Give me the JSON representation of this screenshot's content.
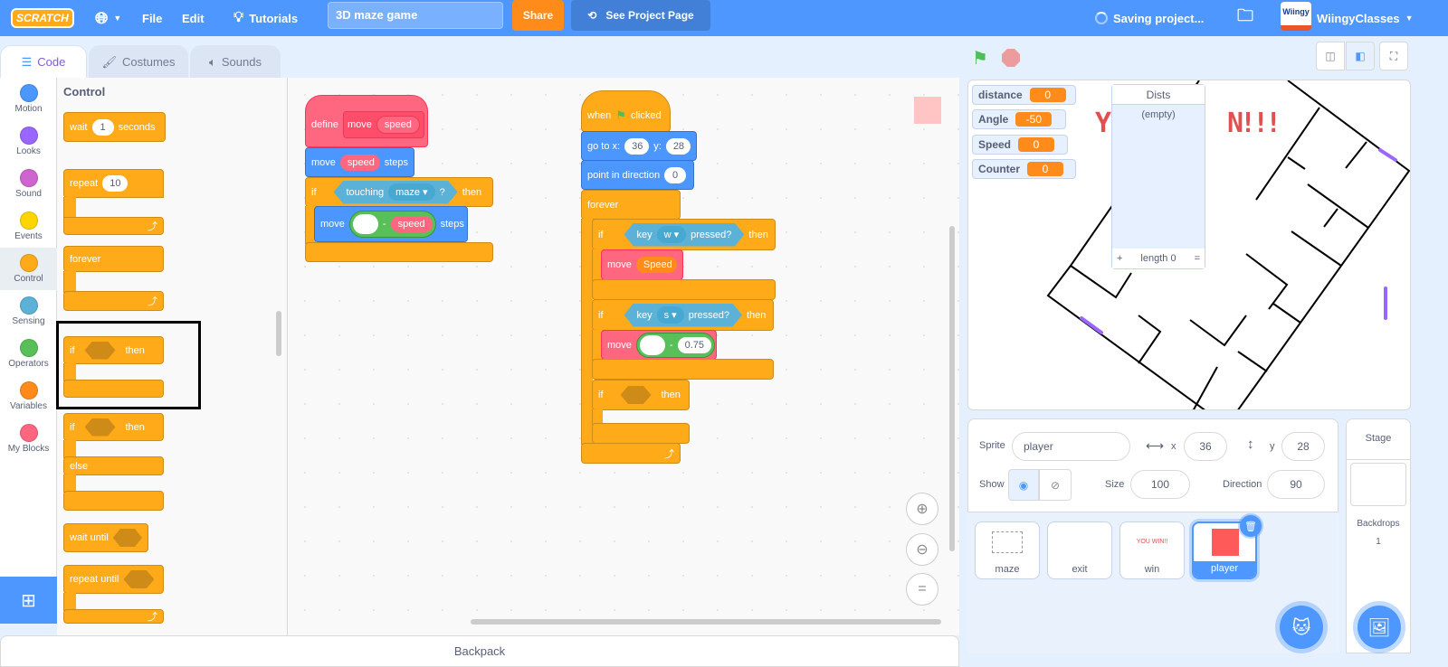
{
  "menu": {
    "logo": "SCRATCH",
    "file": "File",
    "edit": "Edit",
    "tutorials": "Tutorials",
    "project_title": "3D maze game",
    "share": "Share",
    "see_project_page": "See Project Page",
    "saving": "Saving project...",
    "username": "WiingyClasses",
    "avatar_text": "Wiingy"
  },
  "tabs": [
    {
      "label": "Code"
    },
    {
      "label": "Costumes"
    },
    {
      "label": "Sounds"
    }
  ],
  "categories": [
    {
      "label": "Motion",
      "color": "#4c97ff"
    },
    {
      "label": "Looks",
      "color": "#9966ff"
    },
    {
      "label": "Sound",
      "color": "#cf63cf"
    },
    {
      "label": "Events",
      "color": "#ffd500"
    },
    {
      "label": "Control",
      "color": "#ffab19"
    },
    {
      "label": "Sensing",
      "color": "#5cb1d6"
    },
    {
      "label": "Operators",
      "color": "#59c059"
    },
    {
      "label": "Variables",
      "color": "#ff8c1a"
    },
    {
      "label": "My Blocks",
      "color": "#ff6680"
    }
  ],
  "palette": {
    "heading": "Control",
    "wait": {
      "label": "wait",
      "value": "1",
      "suffix": "seconds"
    },
    "repeat": {
      "label": "repeat",
      "value": "10"
    },
    "forever": "forever",
    "if_then": {
      "if": "if",
      "then": "then"
    },
    "if_else": {
      "if": "if",
      "then": "then",
      "else": "else"
    },
    "wait_until": "wait until",
    "repeat_until": "repeat until"
  },
  "script1": {
    "define": "define",
    "proc_name": "move",
    "proc_arg": "speed",
    "move": "move",
    "steps": "steps",
    "if": "if",
    "touching": "touching",
    "touching_target": "maze",
    "q": "?",
    "then": "then",
    "minus": "-"
  },
  "script2": {
    "when": "when",
    "clicked": "clicked",
    "goto": "go to x:",
    "x": "36",
    "y_label": "y:",
    "y": "28",
    "point": "point in direction",
    "direction": "0",
    "forever": "forever",
    "if": "if",
    "key": "key",
    "key_w": "w",
    "key_s": "s",
    "pressed": "pressed?",
    "then": "then",
    "move": "move",
    "speed_var": "Speed",
    "minus": "-",
    "back_value": "0.75"
  },
  "monitors": [
    {
      "label": "distance",
      "value": "0"
    },
    {
      "label": "Angle",
      "value": "-50"
    },
    {
      "label": "Speed",
      "value": "0"
    },
    {
      "label": "Counter",
      "value": "0"
    }
  ],
  "list_monitor": {
    "title": "Dists",
    "empty": "(empty)",
    "add": "+",
    "length": "length 0",
    "resize": "="
  },
  "stage_text": {
    "left": "Y",
    "right": "N!!!"
  },
  "sprite_info": {
    "sprite_label": "Sprite",
    "sprite_name": "player",
    "x_label": "x",
    "x": "36",
    "y_label": "y",
    "y": "28",
    "show_label": "Show",
    "size_label": "Size",
    "size": "100",
    "direction_label": "Direction",
    "direction": "90"
  },
  "sprites": [
    {
      "name": "maze"
    },
    {
      "name": "exit"
    },
    {
      "name": "win",
      "thumb_text": "YOU WIN!!"
    },
    {
      "name": "player",
      "selected": true
    }
  ],
  "stage_pane": {
    "title": "Stage",
    "backdrops_label": "Backdrops",
    "backdrops_count": "1"
  },
  "backpack": "Backpack",
  "colors": {
    "menu": "#4d97ff",
    "control": "#ffab19",
    "motion": "#4c97ff",
    "my_blocks": "#ff6680",
    "share": "#ff8c1a"
  }
}
